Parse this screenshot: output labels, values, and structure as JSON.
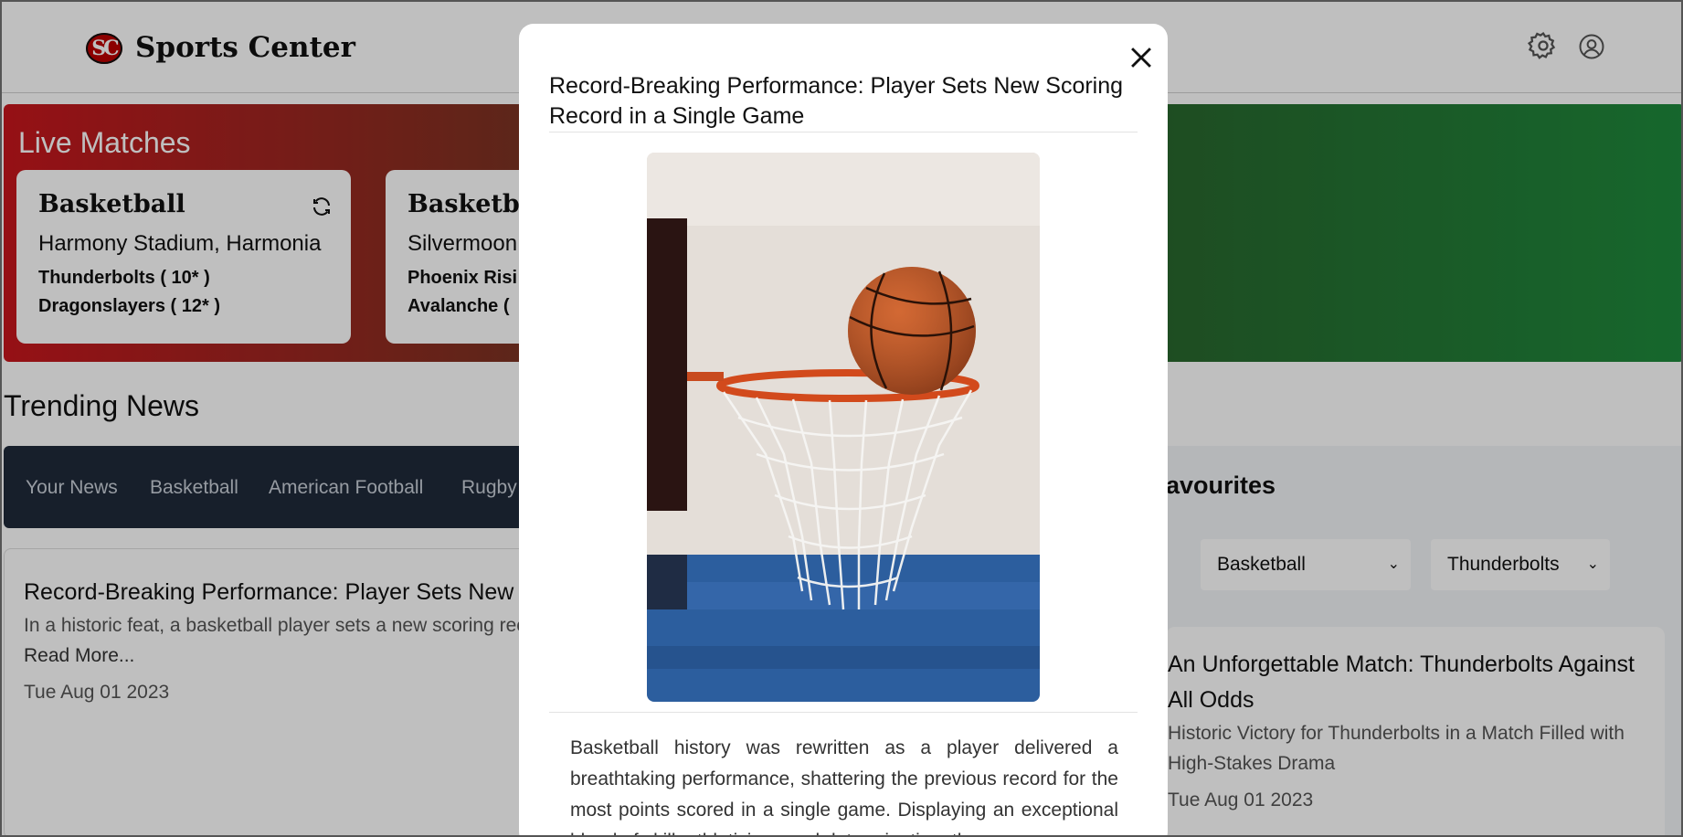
{
  "header": {
    "logo_text": "SC",
    "brand": "Sports Center",
    "icons": [
      "gear-icon",
      "user-icon"
    ]
  },
  "live": {
    "title": "Live Matches",
    "matches": [
      {
        "sport": "Basketball",
        "venue": "Harmony Stadium, Harmonia",
        "team1": "Thunderbolts ( 10* )",
        "team2": "Dragonslayers ( 12* )"
      },
      {
        "sport": "Basketball",
        "venue": "Silvermoon",
        "team1": "Phoenix Risi",
        "team2": "Avalanche ("
      }
    ]
  },
  "trending": {
    "title": "Trending News",
    "tabs": [
      "Your News",
      "Basketball",
      "American Football",
      "Rugby"
    ],
    "article": {
      "title": "Record-Breaking Performance: Player Sets New Scoring Record in a Single Game",
      "summary": "In a historic feat, a basketball player sets a new scoring record, leaving fans and experts in awe of their extraordinary skills.",
      "read_more": "Read More...",
      "date": "Tue Aug 01 2023"
    }
  },
  "favourites": {
    "title": "avourites",
    "sport_select": "Basketball",
    "team_select": "Thunderbolts",
    "article": {
      "title": "An Unforgettable Match: Thunderbolts Against All Odds",
      "summary": "Historic Victory for Thunderbolts in a Match Filled with High-Stakes Drama",
      "date": "Tue Aug 01 2023"
    }
  },
  "modal": {
    "title": "Record-Breaking Performance: Player Sets New Scoring Record in a Single Game",
    "body": "Basketball history was rewritten as a player delivered a breathtaking performance, shattering the previous record for the most points scored in a single game. Displaying an exceptional blend of skill, athleticism, and determination, th"
  },
  "colors": {
    "live_start": "#c8161d",
    "live_end": "#1e8a3c",
    "tabs_bg": "#1f2a3a"
  }
}
